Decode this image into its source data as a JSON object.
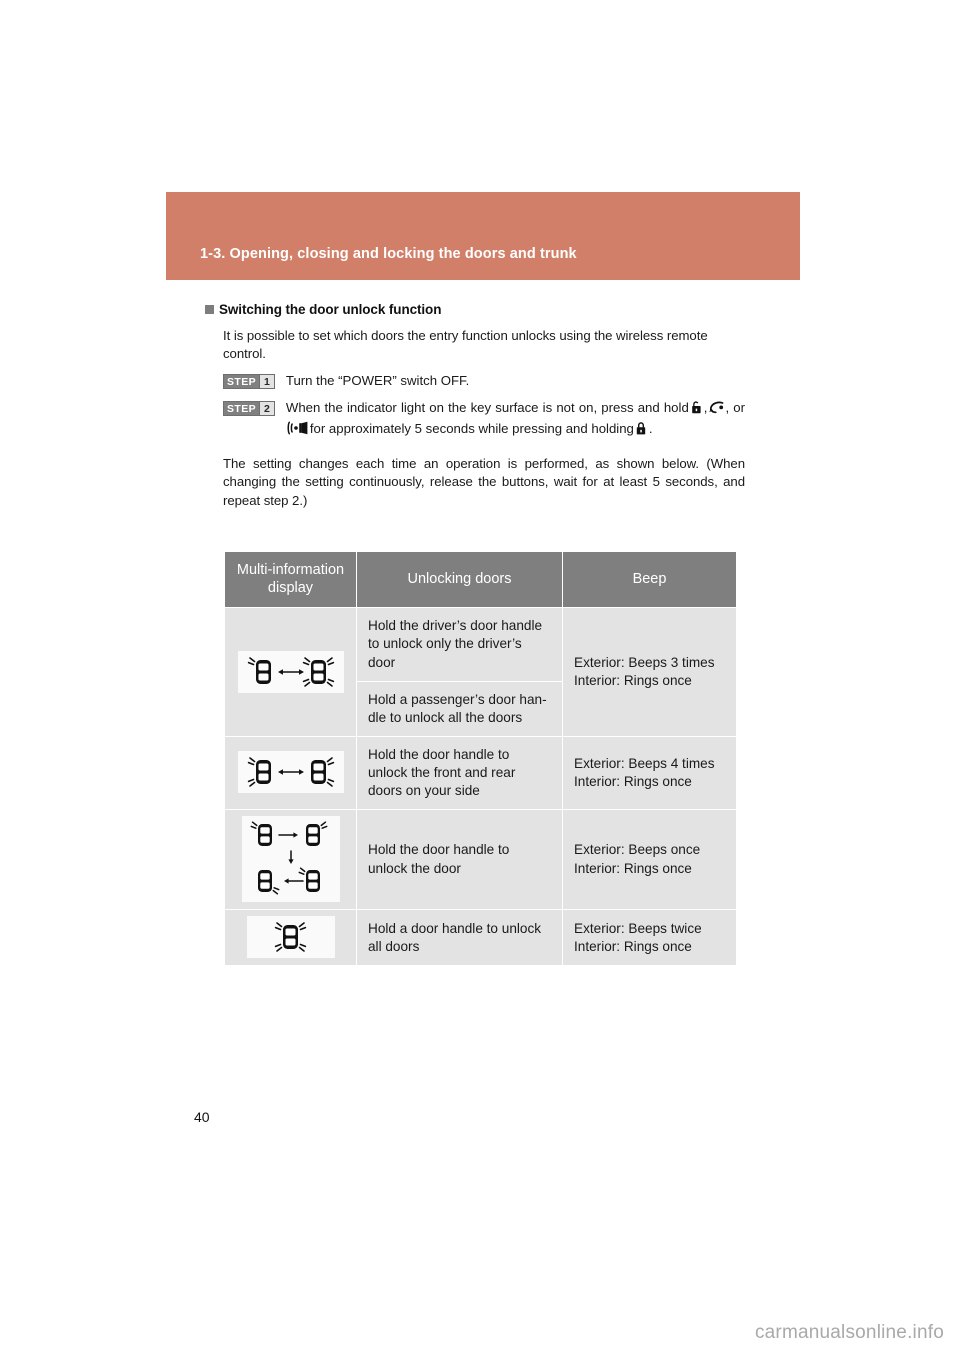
{
  "header": {
    "chapter_title": "1-3. Opening, closing and locking the doors and trunk",
    "bar_color": "#d17f68"
  },
  "section": {
    "heading": "Switching the door unlock function",
    "intro": "It is possible to set which doors the entry function unlocks using the wireless remote control.",
    "steps": [
      {
        "badge_word": "STEP",
        "badge_num": "1",
        "text": "Turn the “POWER” switch OFF."
      },
      {
        "badge_word": "STEP",
        "badge_num": "2",
        "text_part1": "When the indicator light on the key surface is not on, press and hold",
        "sep1": ",",
        "sep2": ", or",
        "text_part2": "for approximately 5 seconds while pressing and holding",
        "text_end": ".",
        "icons": [
          "unlock-icon",
          "trunk-open-icon",
          "panic-alarm-icon",
          "lock-icon"
        ]
      }
    ],
    "note": "The setting changes each time an operation is performed, as shown below. (When changing the setting continuously, release the buttons, wait for at least 5 seconds, and repeat step 2.)"
  },
  "table": {
    "headers": [
      "Multi-information display",
      "Unlocking doors",
      "Beep"
    ],
    "rows": [
      {
        "display_icon": "two-cars-driver-then-all-doors-icon",
        "unlocking": [
          "Hold the driver’s door handle to unlock only the driver’s door",
          "Hold a passenger’s door han-dle to unlock all the doors"
        ],
        "beep": "Exterior: Beeps 3 times\nInterior: Rings once",
        "beep_lines": [
          "Exterior: Beeps 3 times",
          "Interior: Rings once"
        ]
      },
      {
        "display_icon": "two-cars-side-doors-icon",
        "unlocking": [
          "Hold the door handle to unlock the front and rear doors on your side"
        ],
        "beep_lines": [
          "Exterior: Beeps 4 times",
          "Interior: Rings once"
        ]
      },
      {
        "display_icon": "four-cars-single-door-icon",
        "unlocking": [
          "Hold the door handle to unlock the door"
        ],
        "beep_lines": [
          "Exterior: Beeps once",
          "Interior: Rings once"
        ]
      },
      {
        "display_icon": "one-car-all-doors-icon",
        "unlocking": [
          "Hold a door handle to unlock all doors"
        ],
        "beep_lines": [
          "Exterior: Beeps twice",
          "Interior: Rings once"
        ]
      }
    ]
  },
  "footer": {
    "page_number": "40",
    "watermark": "carmanualsonline.info"
  }
}
